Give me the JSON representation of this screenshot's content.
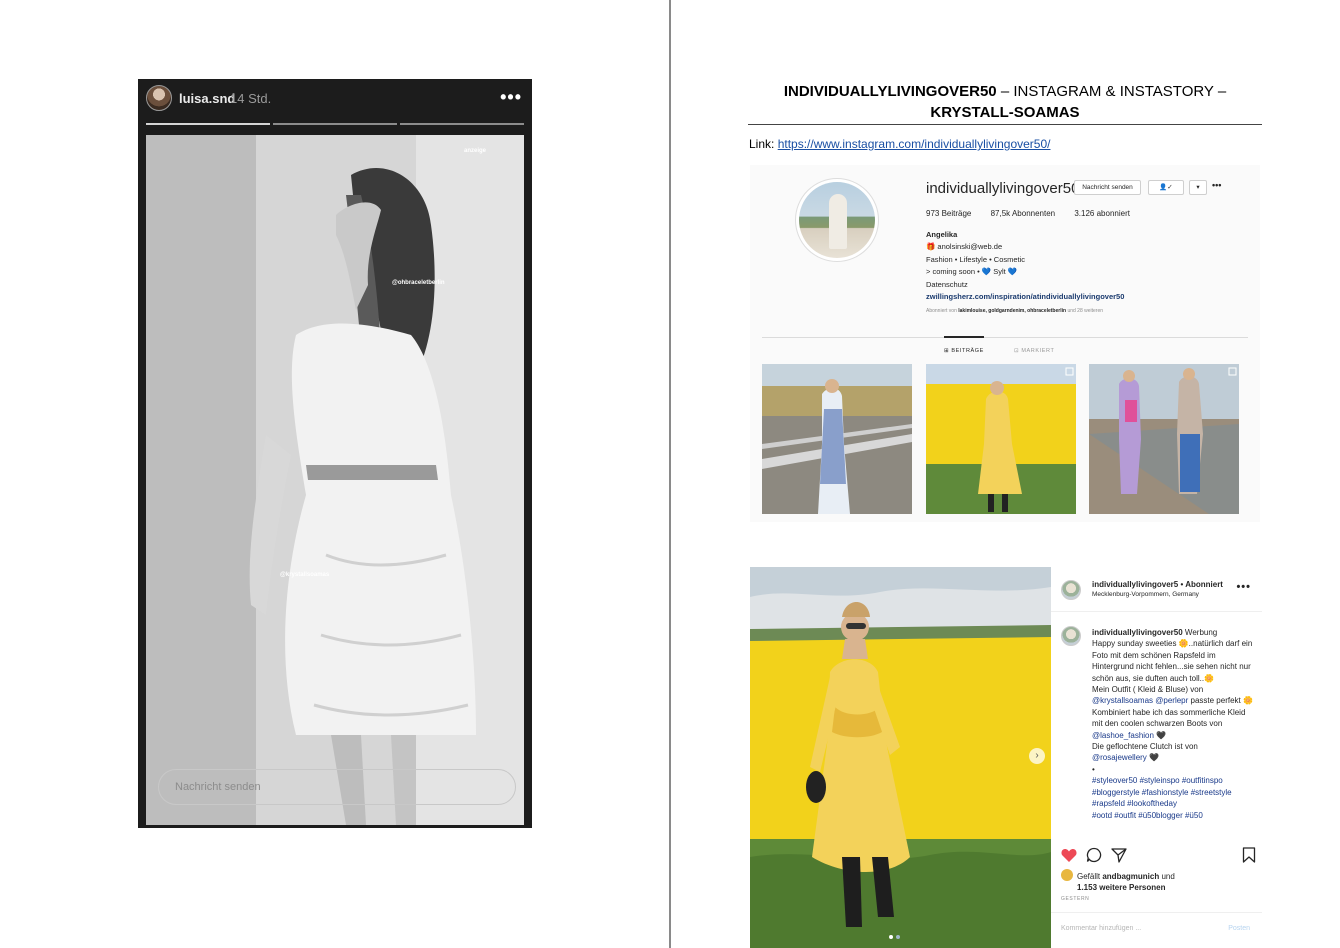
{
  "story": {
    "username": "luisa.snd",
    "time": "14 Std.",
    "more": "•••",
    "tag_ad": "anzeige",
    "tag_bracelet": "@ohbraceletberlin",
    "tag_brand": "@krystallsoamas",
    "input_placeholder": "Nachricht senden"
  },
  "doc": {
    "title_bold": "INDIVIDUALLYLIVINGOVER50",
    "title_rest": " – INSTAGRAM & INSTASTORY –",
    "title_line2": "KRYSTALL-SOAMAS",
    "link_label": "Link: ",
    "link_url": "https://www.instagram.com/individuallylivingover50/"
  },
  "profile": {
    "username": "individuallylivingover50",
    "message_button": "Nachricht senden",
    "follow_button": "👤✓",
    "dropdown_button": "▾",
    "more": "•••",
    "posts": "973 Beiträge",
    "followers": "87,5k Abonnenten",
    "following": "3.126 abonniert",
    "bio_name": "Angelika",
    "bio_email": "🎁 anolsinski@web.de",
    "bio_line1": "Fashion • Lifestyle • Cosmetic",
    "bio_line2": "> coming soon • 💙 Sylt 💙",
    "bio_line3": "Datenschutz",
    "bio_link": "zwillingsherz.com/inspiration/atindividuallylivingover50",
    "followed_prefix": "Abonniert von ",
    "followed_names": "lakimlouise, goldgarndenim, ohbraceletberlin",
    "followed_suffix": " und 28 weiteren",
    "tab_posts": "⊞ BEITRÄGE",
    "tab_tagged": "⊡ MARKIERT"
  },
  "post": {
    "username": "individuallylivingover5",
    "follow_status": " • Abonniert",
    "location": "Mecklenburg-Vorpommern, Germany",
    "more": "•••",
    "next": "›",
    "caption_user": "individuallylivingover50",
    "caption_lines": [
      " Werbung",
      "Happy sunday sweeties 🌼..natürlich darf ein Foto mit dem schönen Rapsfeld im Hintergrund nicht fehlen...sie sehen nicht nur schön aus, sie duften auch toll..🌼",
      "Mein Outfit ( Kleid & Bluse) von",
      "@krystallsoamas",
      " @perlepr",
      " passte perfekt 🌼",
      "Kombiniert habe ich das sommerliche Kleid mit den coolen schwarzen Boots von ",
      "@lashoe_fashion",
      " 🖤",
      "Die geflochtene Clutch ist von",
      "@rosajewellery",
      " 🖤",
      "•",
      "#styleover50 #styleinspo #outfitinspo #bloggerstyle #fashionstyle #streetstyle #rapsfeld #lookoftheday",
      "#ootd #outfit #ü50blogger #ü50"
    ],
    "likes_prefix": "Gefällt ",
    "likes_user": "andbagmunich",
    "likes_mid": " und",
    "likes_count": "1.153 weitere Personen",
    "date": "GESTERN",
    "comment_placeholder": "Kommentar hinzufügen ...",
    "post_button": "Posten"
  },
  "colors": {
    "link_blue": "#1a4fa3",
    "heart_red": "#ed4956",
    "rapeseed_yellow": "#f2d21b",
    "dress_yellow": "#f3d25a"
  }
}
